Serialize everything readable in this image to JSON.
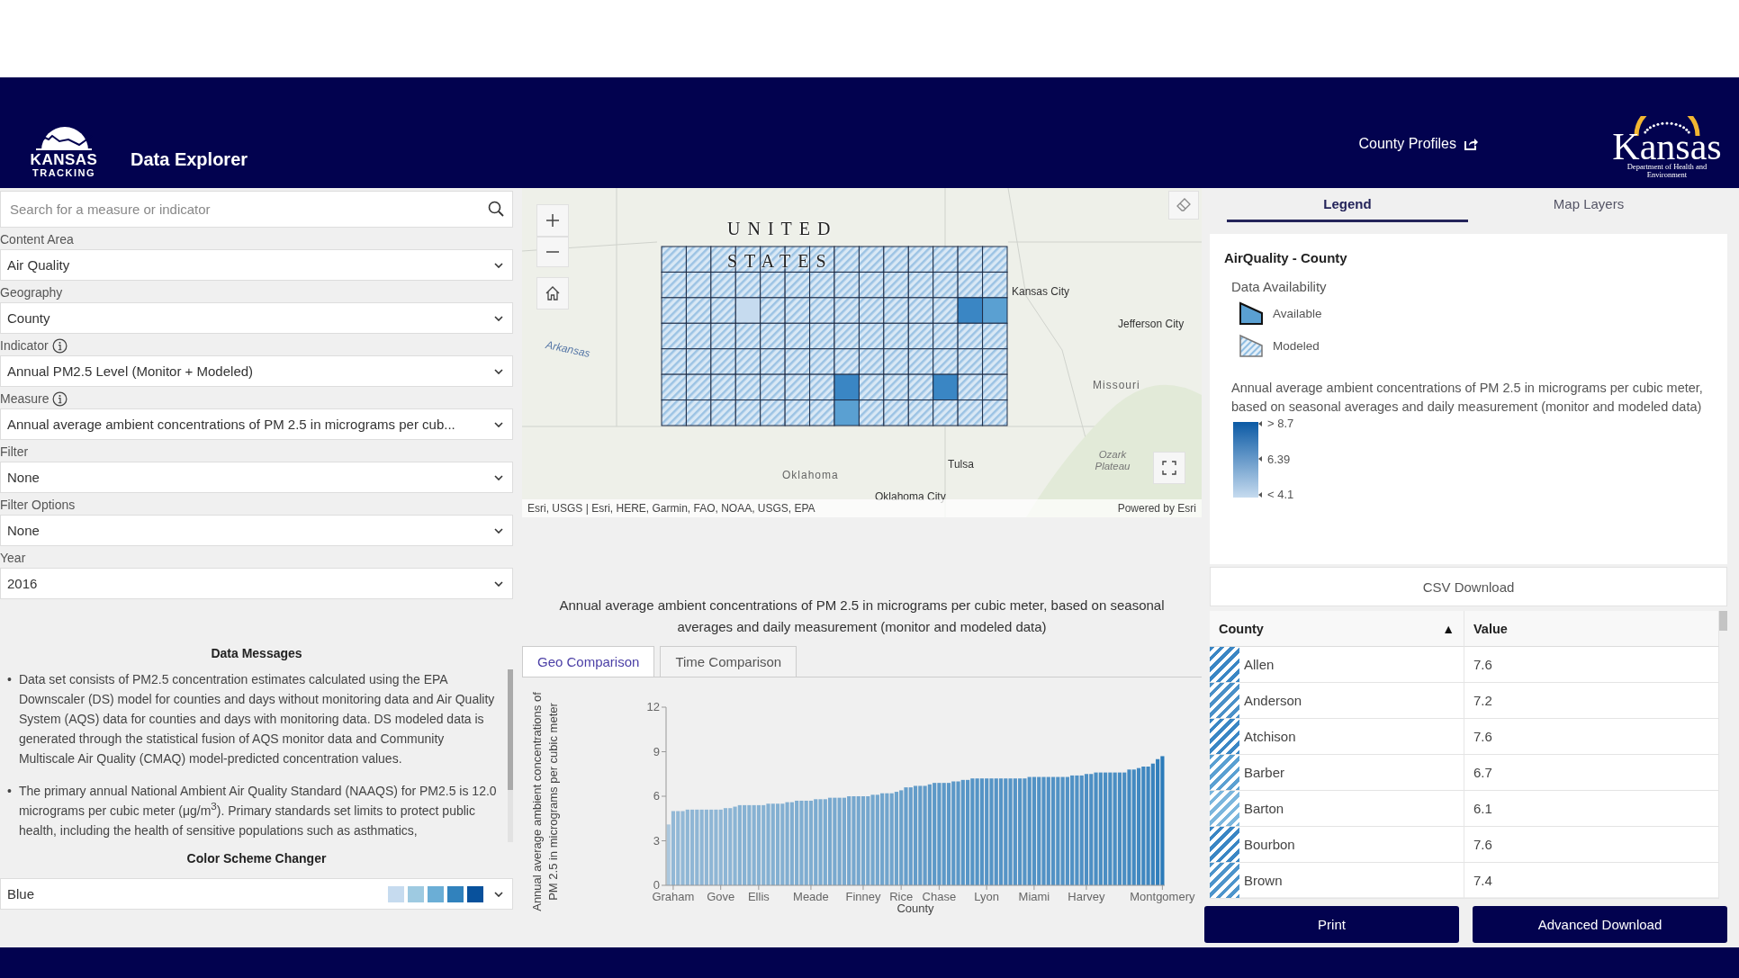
{
  "header": {
    "logo_top": "KANSAS",
    "logo_bottom": "TRACKING",
    "title": "Data Explorer",
    "link": "County Profiles",
    "agency_name": "Kansas",
    "agency_subtitle": "Department of Health and Environment"
  },
  "search": {
    "placeholder": "Search for a measure or indicator"
  },
  "filters": [
    {
      "label": "Content Area",
      "value": "Air Quality",
      "info": false
    },
    {
      "label": "Geography",
      "value": "County",
      "info": false
    },
    {
      "label": "Indicator",
      "value": "Annual PM2.5 Level (Monitor + Modeled)",
      "info": true
    },
    {
      "label": "Measure",
      "value": "Annual average ambient concentrations of PM 2.5 in micrograms per cub...",
      "info": true
    },
    {
      "label": "Filter",
      "value": "None",
      "info": false
    },
    {
      "label": "Filter Options",
      "value": "None",
      "info": false
    },
    {
      "label": "Year",
      "value": "2016",
      "info": false
    }
  ],
  "data_messages": {
    "title": "Data Messages",
    "items": [
      {
        "marker": "•",
        "text": "Data set consists of PM2.5 concentration estimates calculated using the EPA Downscaler (DS) model for counties and days without monitoring data and Air Quality System (AQS) data for counties and days with monitoring data. DS modeled data is generated through the statistical fusion of AQS monitor data and Community Multiscale Air Quality (CMAQ) model-predicted concentration values."
      },
      {
        "marker": "•",
        "text": "The primary annual National Ambient Air Quality Standard (NAAQS) for PM2.5 is 12.0 micrograms per cubic meter (μg/m$^{3}$). Primary standards set limits to protect public health, including the health of sensitive populations such as asthmatics,"
      }
    ]
  },
  "color_scheme": {
    "title": "Color Scheme Changer",
    "value": "Blue",
    "swatches": [
      {
        "color": "#c6dbef"
      },
      {
        "color": "#9ecae1"
      },
      {
        "color": "#6baed6"
      },
      {
        "color": "#3182bd"
      },
      {
        "color": "#08519c"
      }
    ]
  },
  "map": {
    "labels": [
      "UNITED",
      "STATES",
      "Kansas City",
      "Jefferson City",
      "Missouri",
      "Arkansas",
      "Tulsa",
      "Oklahoma",
      "Ozark Plateau",
      "Oklahoma City"
    ],
    "attribution": "Esri, USGS | Esri, HERE, Garmin, FAO, NOAA, USGS, EPA",
    "powered_by": "Powered by Esri"
  },
  "chart_panel": {
    "title": "Annual average ambient concentrations of PM 2.5 in micrograms per cubic meter, based on seasonal averages and daily measurement (monitor and modeled data)",
    "tabs": [
      {
        "label": "Geo Comparison",
        "selected": true
      },
      {
        "label": "Time Comparison",
        "selected": false
      }
    ],
    "chart_data": {
      "type": "bar",
      "xlabel": "County",
      "ylabel": "Annual average ambient concentrations of PM 2.5 in micrograms per cubic meter",
      "ylim": [
        0,
        12
      ],
      "yticks": [
        0,
        3,
        6,
        9,
        12
      ],
      "categories": [
        null,
        "Graham",
        null,
        null,
        null,
        null,
        null,
        null,
        null,
        null,
        null,
        "Gove",
        null,
        null,
        null,
        null,
        null,
        null,
        null,
        "Ellis",
        null,
        null,
        null,
        null,
        null,
        null,
        null,
        null,
        null,
        null,
        "Meade",
        null,
        null,
        null,
        null,
        null,
        null,
        null,
        null,
        null,
        null,
        "Finney",
        null,
        null,
        null,
        null,
        null,
        null,
        null,
        "Rice",
        null,
        null,
        null,
        null,
        null,
        null,
        null,
        "Chase",
        null,
        null,
        null,
        null,
        null,
        null,
        null,
        null,
        null,
        "Lyon",
        null,
        null,
        null,
        null,
        null,
        null,
        null,
        null,
        null,
        "Miami",
        null,
        null,
        null,
        null,
        null,
        null,
        null,
        null,
        null,
        null,
        "Harvey",
        null,
        null,
        null,
        null,
        null,
        null,
        null,
        null,
        null,
        null,
        null,
        null,
        null,
        null,
        null,
        "Montgomery"
      ],
      "series": [
        {
          "color": "#2b7bba",
          "values": [
            4.1,
            5.0,
            5.0,
            5.0,
            5.1,
            5.1,
            5.1,
            5.1,
            5.1,
            5.1,
            5.1,
            5.1,
            5.2,
            5.2,
            5.3,
            5.4,
            5.4,
            5.4,
            5.4,
            5.4,
            5.4,
            5.5,
            5.5,
            5.5,
            5.5,
            5.6,
            5.6,
            5.7,
            5.7,
            5.7,
            5.7,
            5.8,
            5.8,
            5.8,
            5.9,
            5.9,
            5.9,
            5.9,
            6.0,
            6.0,
            6.0,
            6.0,
            6.0,
            6.1,
            6.1,
            6.2,
            6.2,
            6.2,
            6.3,
            6.4,
            6.6,
            6.6,
            6.7,
            6.7,
            6.7,
            6.8,
            6.9,
            6.9,
            6.9,
            6.9,
            7.0,
            7.0,
            7.1,
            7.1,
            7.2,
            7.2,
            7.2,
            7.2,
            7.2,
            7.2,
            7.2,
            7.2,
            7.2,
            7.2,
            7.2,
            7.2,
            7.3,
            7.3,
            7.3,
            7.3,
            7.3,
            7.3,
            7.3,
            7.3,
            7.3,
            7.4,
            7.4,
            7.4,
            7.5,
            7.5,
            7.6,
            7.6,
            7.6,
            7.6,
            7.6,
            7.6,
            7.6,
            7.8,
            7.8,
            7.9,
            8.0,
            8.0,
            8.2,
            8.5,
            8.7
          ]
        }
      ]
    }
  },
  "legend_panel": {
    "tabs": [
      {
        "label": "Legend",
        "selected": true
      },
      {
        "label": "Map Layers",
        "selected": false
      }
    ],
    "layer_title": "AirQuality - County",
    "availability_title": "Data Availability",
    "availability": [
      {
        "label": "Available",
        "kind": "solid"
      },
      {
        "label": "Modeled",
        "kind": "hatched"
      }
    ],
    "description": "Annual average ambient concentrations of PM 2.5 in micrograms per cubic meter, based on seasonal averages and daily measurement (monitor and modeled data)",
    "ramp_labels": [
      "> 8.7",
      "6.39",
      "< 4.1"
    ]
  },
  "csv_button": "CSV Download",
  "table": {
    "columns": [
      {
        "label": "County",
        "sort_indicator": "▲"
      },
      {
        "label": "Value"
      }
    ],
    "rows": [
      {
        "county": "Allen",
        "value": "7.6",
        "color": "#3a86c4"
      },
      {
        "county": "Anderson",
        "value": "7.2",
        "color": "#4a90c8"
      },
      {
        "county": "Atchison",
        "value": "7.6",
        "color": "#3a86c4"
      },
      {
        "county": "Barber",
        "value": "6.7",
        "color": "#5aa0d2"
      },
      {
        "county": "Barton",
        "value": "6.1",
        "color": "#7bb6dd"
      },
      {
        "county": "Bourbon",
        "value": "7.6",
        "color": "#3a86c4"
      },
      {
        "county": "Brown",
        "value": "7.4",
        "color": "#4d94cb"
      }
    ]
  },
  "buttons": [
    "Print",
    "Advanced Download"
  ]
}
